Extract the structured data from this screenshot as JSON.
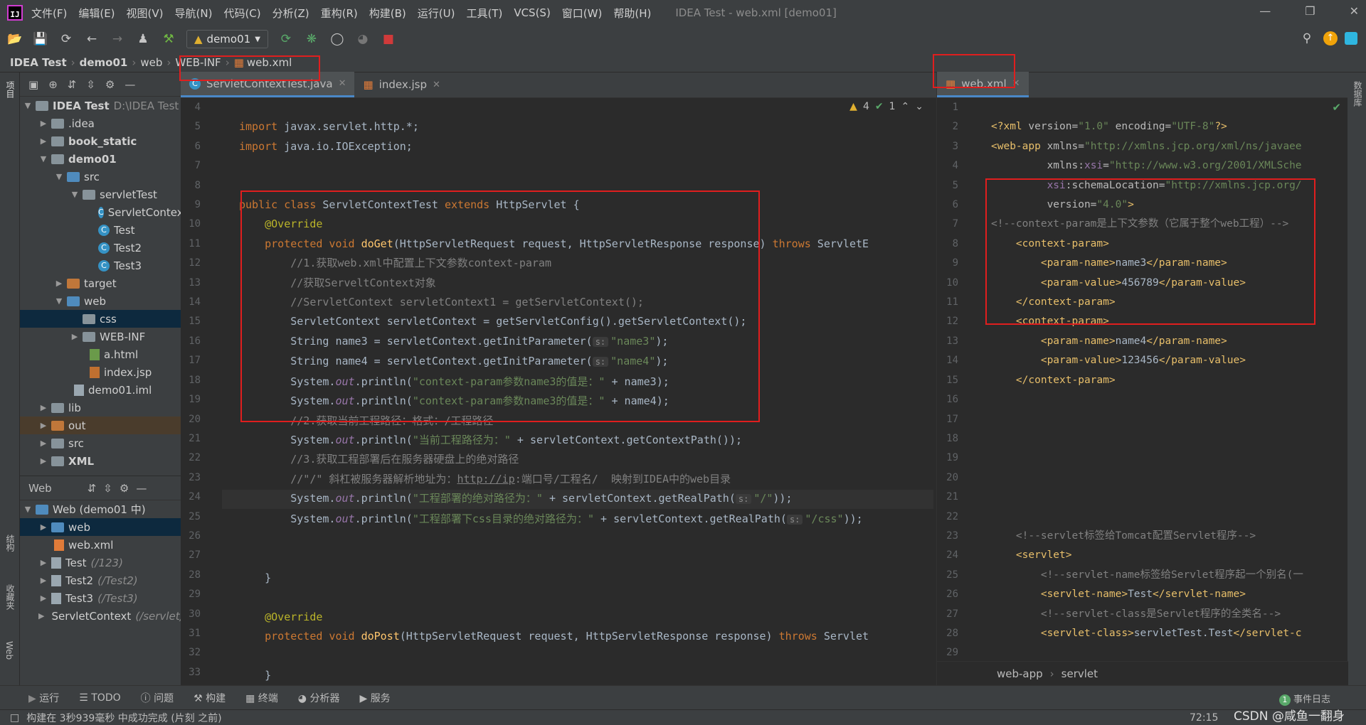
{
  "menu": {
    "items": [
      "文件(F)",
      "编辑(E)",
      "视图(V)",
      "导航(N)",
      "代码(C)",
      "分析(Z)",
      "重构(R)",
      "构建(B)",
      "运行(U)",
      "工具(T)",
      "VCS(S)",
      "窗口(W)",
      "帮助(H)"
    ],
    "window_title": "IDEA Test - web.xml [demo01]"
  },
  "toolbar": {
    "run_config": "demo01"
  },
  "breadcrumb": [
    "IDEA Test",
    "demo01",
    "web",
    "WEB-INF",
    "web.xml"
  ],
  "left_strip": {
    "project": "项目",
    "structure": "结构",
    "favorites": "收藏夹",
    "web": "Web"
  },
  "right_strip": {
    "database": "数据库"
  },
  "project_tree": [
    {
      "label": "IDEA Test",
      "extra": "D:\\IDEA Test",
      "bold": true
    },
    {
      "label": ".idea"
    },
    {
      "label": "book_static",
      "bold": true
    },
    {
      "label": "demo01",
      "bold": true
    },
    {
      "label": "src"
    },
    {
      "label": "servletTest"
    },
    {
      "label": "ServletContextTest"
    },
    {
      "label": "Test"
    },
    {
      "label": "Test2"
    },
    {
      "label": "Test3"
    },
    {
      "label": "target"
    },
    {
      "label": "web"
    },
    {
      "label": "css"
    },
    {
      "label": "WEB-INF"
    },
    {
      "label": "a.html"
    },
    {
      "label": "index.jsp"
    },
    {
      "label": "demo01.iml"
    },
    {
      "label": "lib"
    },
    {
      "label": "out"
    },
    {
      "label": "src"
    },
    {
      "label": "XML",
      "bold": true
    }
  ],
  "web_panel": {
    "title": "Web",
    "items": [
      {
        "label": "Web (demo01 中)"
      },
      {
        "label": "web"
      },
      {
        "label": "web.xml"
      },
      {
        "label": "Test",
        "extra": "(/123)"
      },
      {
        "label": "Test2",
        "extra": "(/Test2)"
      },
      {
        "label": "Test3",
        "extra": "(/Test3)"
      },
      {
        "label": "ServletContext",
        "extra": "(/servlet)"
      }
    ]
  },
  "tabs_left": [
    {
      "label": "ServletContextTest.java",
      "active": true
    },
    {
      "label": "index.jsp",
      "active": false
    }
  ],
  "tab_right": {
    "label": "web.xml"
  },
  "inspections": {
    "warnings": "4",
    "ok": "1"
  },
  "java_lines": [
    "4",
    "5",
    "6",
    "7",
    "8",
    "9",
    "10",
    "11",
    "12",
    "13",
    "14",
    "15",
    "16",
    "17",
    "18",
    "19",
    "20",
    "21",
    "22",
    "23",
    "24",
    "25",
    "26",
    "27",
    "28",
    "29",
    "30",
    "31",
    "32",
    "33"
  ],
  "xml_lines": [
    "1",
    "2",
    "3",
    "4",
    "5",
    "6",
    "7",
    "8",
    "9",
    "10",
    "11",
    "12",
    "13",
    "14",
    "15",
    "16",
    "17",
    "18",
    "19",
    "20",
    "21",
    "22",
    "23",
    "24",
    "25",
    "26",
    "27",
    "28",
    "29"
  ],
  "xml_breadcrumb": [
    "web-app",
    "servlet"
  ],
  "bottom_tools": [
    "运行",
    "TODO",
    "问题",
    "构建",
    "终端",
    "分析器",
    "服务"
  ],
  "event_log": "事件日志",
  "status": {
    "message": "构建在 3秒939毫秒 中成功完成 (片刻 之前)",
    "position": "72:15",
    "watermark": "CSDN @咸鱼一翻身"
  }
}
